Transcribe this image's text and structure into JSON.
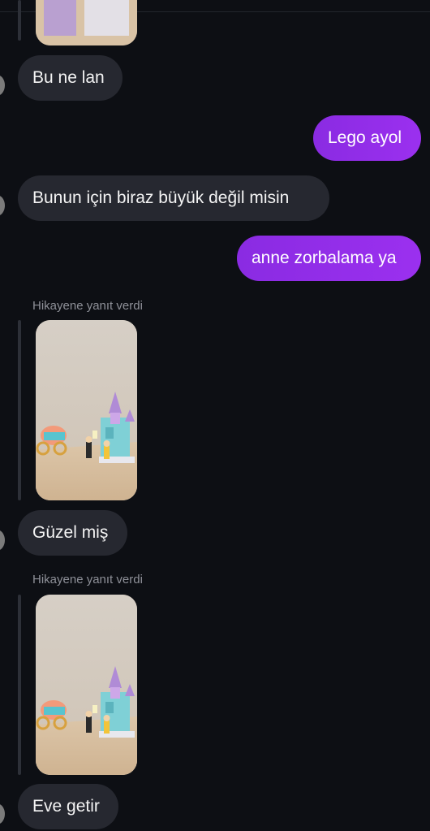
{
  "messages": [
    {
      "id": "m1",
      "text": "Bu ne lan",
      "from": "them"
    },
    {
      "id": "m2",
      "text": "Lego ayol",
      "from": "me"
    },
    {
      "id": "m3",
      "text": "Bunun için biraz büyük değil misin",
      "from": "them"
    },
    {
      "id": "m4",
      "text": "anne zorbalama ya",
      "from": "me"
    },
    {
      "id": "m5",
      "text": "Güzel miş",
      "from": "them"
    },
    {
      "id": "m6",
      "text": "Eve getir",
      "from": "them"
    }
  ],
  "story_replies": [
    {
      "caption": "Hikayene yanıt verdi",
      "image": "lego-castle-carriage-photo"
    },
    {
      "caption": "Hikayene yanıt verdi",
      "image": "lego-castle-carriage-photo"
    }
  ],
  "colors": {
    "background": "#0d0f14",
    "incoming_bubble": "#262830",
    "outgoing_bubble": "#9431ea"
  }
}
